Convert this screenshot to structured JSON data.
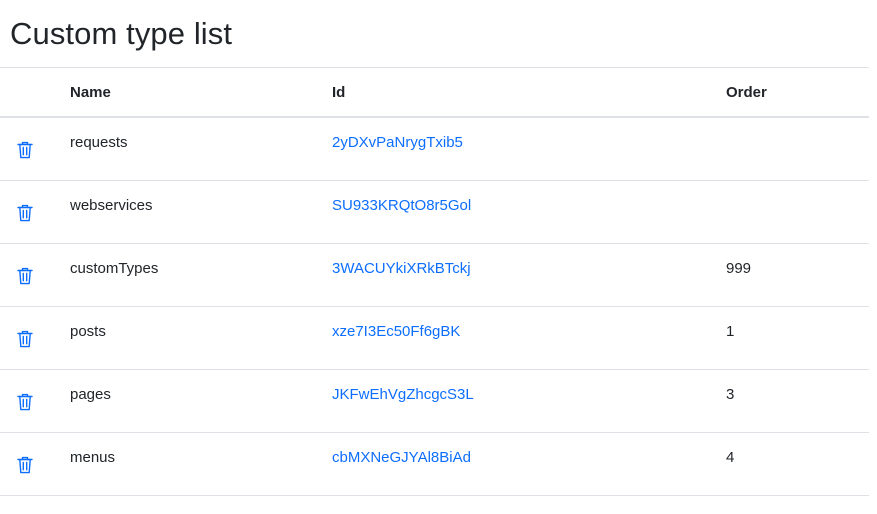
{
  "page": {
    "title": "Custom type list"
  },
  "table": {
    "headers": {
      "name": "Name",
      "id": "Id",
      "order": "Order"
    },
    "rows": [
      {
        "name": "requests",
        "id": "2yDXvPaNrygTxib5",
        "order": ""
      },
      {
        "name": "webservices",
        "id": "SU933KRQtO8r5Gol",
        "order": ""
      },
      {
        "name": "customTypes",
        "id": "3WACUYkiXRkBTckj",
        "order": "999"
      },
      {
        "name": "posts",
        "id": "xze7I3Ec50Ff6gBK",
        "order": "1"
      },
      {
        "name": "pages",
        "id": "JKFwEhVgZhcgcS3L",
        "order": "3"
      },
      {
        "name": "menus",
        "id": "cbMXNeGJYAl8BiAd",
        "order": "4"
      }
    ]
  },
  "icons": {
    "delete": "trash-icon"
  },
  "colors": {
    "link": "#0d6efd",
    "text": "#212529",
    "border": "#dee2e6"
  }
}
